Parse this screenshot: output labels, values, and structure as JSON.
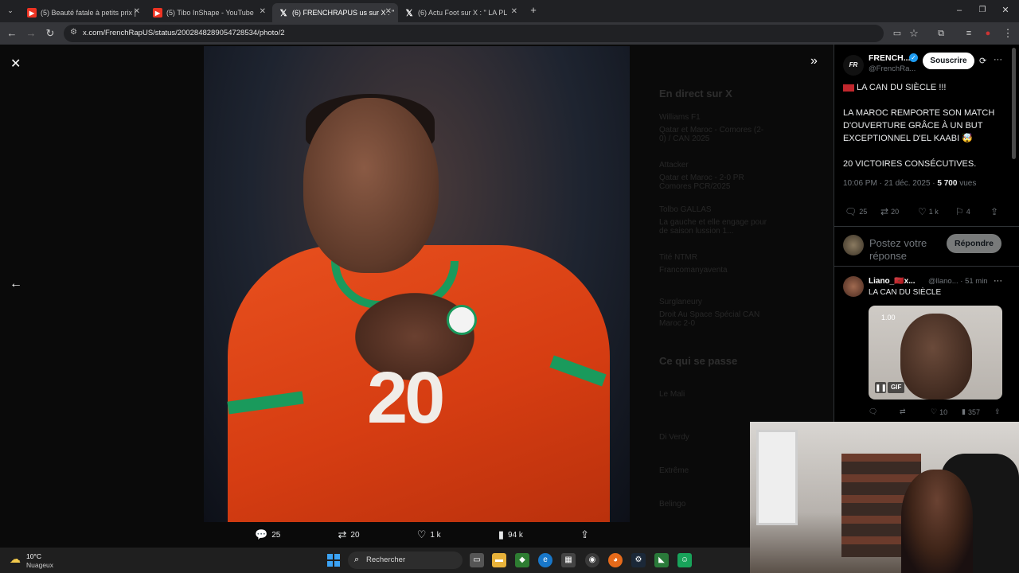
{
  "tabs": [
    {
      "title": "(5) Beauté fatale à petits prix | ",
      "icon": "youtube-icon"
    },
    {
      "title": "(5) Tibo InShape - YouTube",
      "icon": "youtube-icon"
    },
    {
      "title": "(6) FRENCHRAPUS us sur X : \"",
      "icon": "x-icon"
    },
    {
      "title": "(6) Actu Foot sur X : \" LA PL",
      "icon": "x-icon"
    }
  ],
  "address": {
    "url": "x.com/FrenchRapUS/status/2002848289054728534/photo/2"
  },
  "background_feed": {
    "live_header": "En direct sur X",
    "live_items": [
      {
        "user": "Williams F1",
        "text": "Qatar et Maroc - Comores (2-0) / CAN 2025"
      },
      {
        "user": "Attacker",
        "text": "Qatar et Maroc - 2-0 PR Comores PCR/2025"
      },
      {
        "user": "Tolbo GALLAS",
        "text": "La gauche et elle engage pour de saison lussion 1..."
      },
      {
        "user": "Tité NTMR",
        "text": "Francomanyaventa"
      },
      {
        "user": "Surglaneury",
        "text": "Droit Au Space Spécial CAN Maroc 2-0"
      }
    ],
    "trending_header": "Ce qui se passe",
    "trending_items": [
      "Le Mali",
      "Di Verdy",
      "Extrême",
      "Belingo"
    ]
  },
  "photo": {
    "jersey_number": "20"
  },
  "photo_actions": {
    "replies": "25",
    "reposts": "20",
    "likes": "1 k",
    "views": "94 k"
  },
  "tweet": {
    "author_name": "FRENCH...",
    "author_handle": "@FrenchRa...",
    "avatar_text": "FR",
    "subscribe_label": "Souscrire",
    "line1": "LA CAN DU SIÈCLE !!!",
    "line2": "LA MAROC REMPORTE SON MATCH D'OUVERTURE GRÂCE À UN BUT EXCEPTIONNEL D'EL KAABI 🤯",
    "line3": "20 VICTOIRES CONSÉCUTIVES.",
    "time": "10:06 PM · 21 déc. 2025 · ",
    "views_count": "5 700",
    "views_label": " vues",
    "replies": "25",
    "reposts": "20",
    "likes": "1 k",
    "bookmarks": "4"
  },
  "reply_box": {
    "placeholder": "Postez votre réponse",
    "button_label": "Répondre"
  },
  "reply": {
    "author_name": "Liano_🇲🇦x...",
    "meta": "@llano... · 51 min",
    "text": "LA CAN DU SIÈCLE",
    "gif_time": "1.00",
    "gif_label": "GIF",
    "replies": "",
    "likes": "10",
    "views": "357"
  },
  "taskbar": {
    "weather_temp": "10°C",
    "weather_desc": "Nuageux",
    "search_placeholder": "Rechercher"
  },
  "colors": {
    "accent": "#1d9bf0",
    "jersey": "#d63d12",
    "trim": "#1a9a5c"
  }
}
